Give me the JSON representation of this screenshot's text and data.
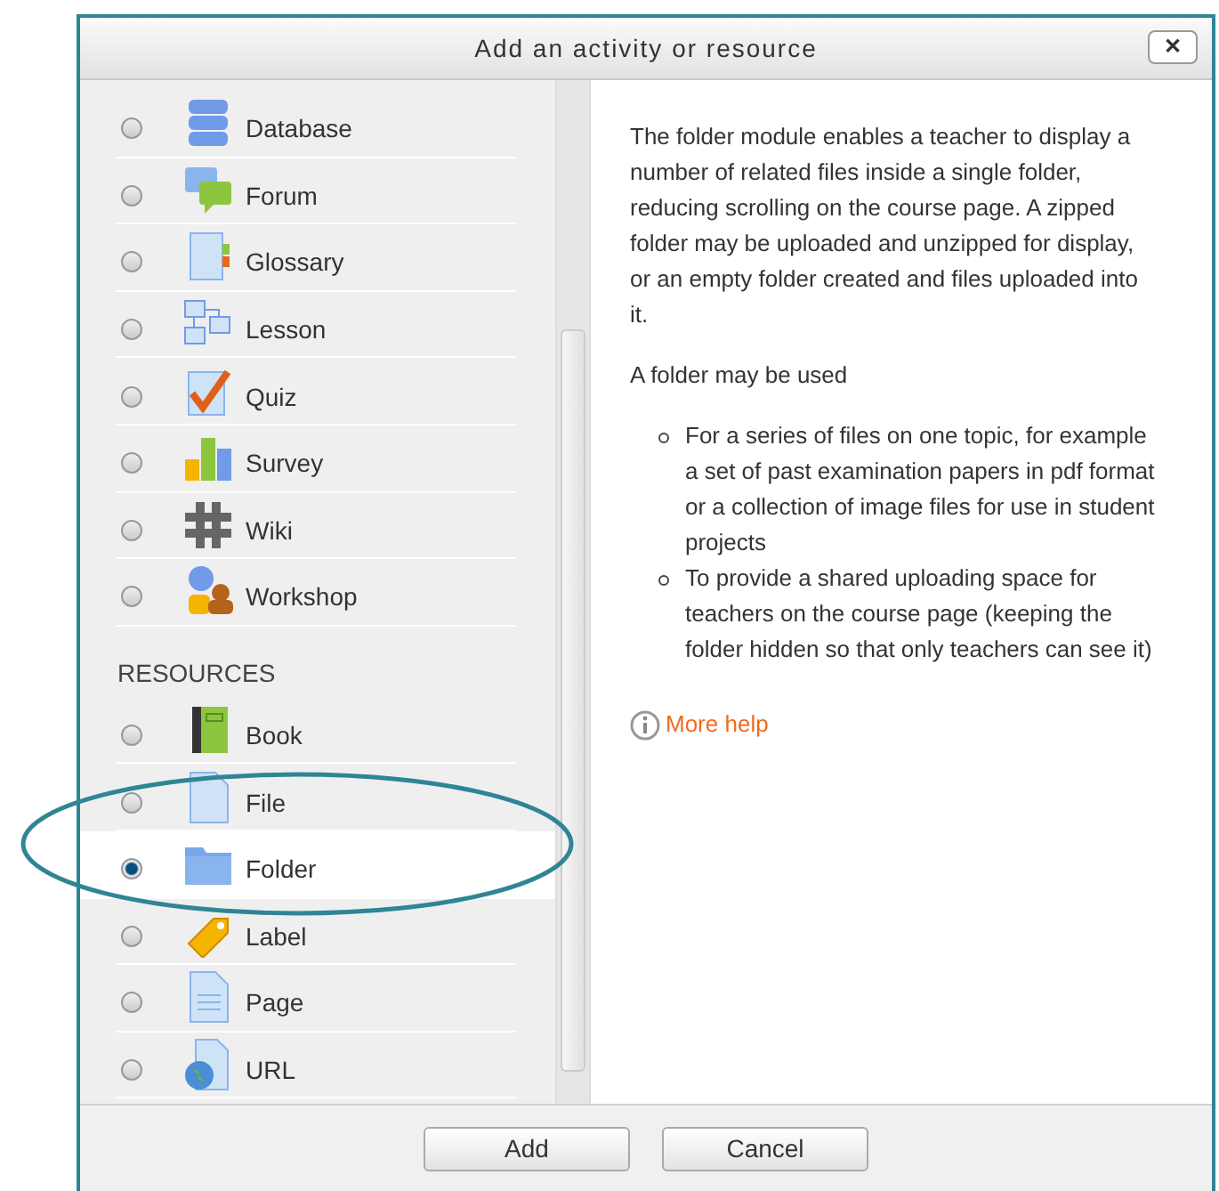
{
  "dialog": {
    "title": "Add an activity or resource",
    "close": "✕"
  },
  "activities": [
    {
      "label": "Database",
      "selected": false
    },
    {
      "label": "Forum",
      "selected": false
    },
    {
      "label": "Glossary",
      "selected": false
    },
    {
      "label": "Lesson",
      "selected": false
    },
    {
      "label": "Quiz",
      "selected": false
    },
    {
      "label": "Survey",
      "selected": false
    },
    {
      "label": "Wiki",
      "selected": false
    },
    {
      "label": "Workshop",
      "selected": false
    }
  ],
  "resources_heading": "RESOURCES",
  "resources": [
    {
      "label": "Book",
      "selected": false
    },
    {
      "label": "File",
      "selected": false
    },
    {
      "label": "Folder",
      "selected": true
    },
    {
      "label": "Label",
      "selected": false
    },
    {
      "label": "Page",
      "selected": false
    },
    {
      "label": "URL",
      "selected": false
    }
  ],
  "description": {
    "paragraph": "The folder module enables a teacher to display a number of related files inside a single folder, reducing scrolling on the course page. A zipped folder may be uploaded and unzipped for display, or an empty folder created and files uploaded into it.",
    "lead": "A folder may be used",
    "bullets": [
      "For a series of files on one topic, for example a set of past examination papers in pdf format or a collection of image files for use in student projects",
      "To provide a shared uploading space for teachers on the course page (keeping the folder hidden so that only teachers can see it)"
    ],
    "more_help": "More help"
  },
  "buttons": [
    "Add",
    "Cancel"
  ]
}
